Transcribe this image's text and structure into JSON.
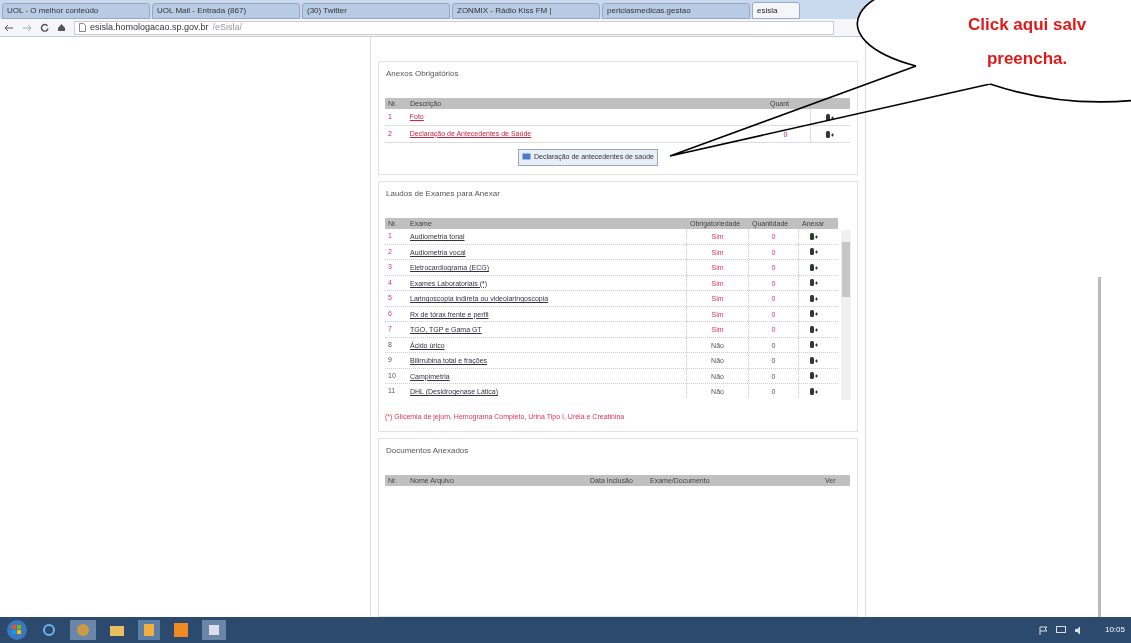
{
  "browser": {
    "tabs": [
      {
        "title": "UOL - O melhor conteúdo",
        "selected": false
      },
      {
        "title": "UOL Mail - Entrada (867)",
        "selected": false
      },
      {
        "title": "(30) Twitter",
        "selected": false
      },
      {
        "title": "ZONMIX - Rádio Kiss FM |",
        "selected": false
      },
      {
        "title": "periciasmedicas.gestao",
        "selected": false
      },
      {
        "title": "esisla",
        "selected": true
      }
    ],
    "address": {
      "host": "esisla.homologacao.sp.gov.br",
      "path": "/eSisla/"
    }
  },
  "callout": {
    "lines": [
      "Click aqui salv",
      "preencha."
    ]
  },
  "anexos_obrigatorios": {
    "legend": "Anexos Obrigatórios",
    "columns": [
      "Nr.",
      "Descrição",
      "Quant"
    ],
    "rows": [
      {
        "nr": "1",
        "descricao": "Foto",
        "quantidade": ""
      },
      {
        "nr": "2",
        "descricao": "Declaração de Antecedentes de Saúde",
        "quantidade": "0"
      }
    ],
    "button": "Declaração de antecedentes de saúde"
  },
  "laudos": {
    "legend": "Laudos de Exames para Anexar",
    "columns": [
      "Nr.",
      "Exame",
      "Obrigatoriedade",
      "Quantidade",
      "Anexar"
    ],
    "rows": [
      {
        "nr": "1",
        "exame": "Audiometria tonal",
        "obrigatoriedade": "Sim",
        "quantidade": "0",
        "required": true
      },
      {
        "nr": "2",
        "exame": "Audiometria vocal",
        "obrigatoriedade": "Sim",
        "quantidade": "0",
        "required": true
      },
      {
        "nr": "3",
        "exame": "Eletrocardiograma (ECG)",
        "obrigatoriedade": "Sim",
        "quantidade": "0",
        "required": true
      },
      {
        "nr": "4",
        "exame": "Exames Laboratoriais (*)",
        "obrigatoriedade": "Sim",
        "quantidade": "0",
        "required": true
      },
      {
        "nr": "5",
        "exame": "Laringoscopia indireta ou videolaringoscopia",
        "obrigatoriedade": "Sim",
        "quantidade": "0",
        "required": true
      },
      {
        "nr": "6",
        "exame": "Rx de tórax frente e perfil",
        "obrigatoriedade": "Sim",
        "quantidade": "0",
        "required": true
      },
      {
        "nr": "7",
        "exame": "TGO, TGP e Gama GT",
        "obrigatoriedade": "Sim",
        "quantidade": "0",
        "required": true
      },
      {
        "nr": "8",
        "exame": "Ácido úrico",
        "obrigatoriedade": "Não",
        "quantidade": "0",
        "required": false
      },
      {
        "nr": "9",
        "exame": "Bilirrubina total e frações",
        "obrigatoriedade": "Não",
        "quantidade": "0",
        "required": false
      },
      {
        "nr": "10",
        "exame": "Campimetria",
        "obrigatoriedade": "Não",
        "quantidade": "0",
        "required": false
      },
      {
        "nr": "11",
        "exame": "DHL (Desidrogenase Lática)",
        "obrigatoriedade": "Não",
        "quantidade": "0",
        "required": false
      }
    ],
    "note": "(*) Glicemia de jejum, Hemograma Completo, Urina Tipo I, Uréia e Creatinina"
  },
  "documentos": {
    "legend": "Documentos Anexados",
    "columns": [
      "Nr.",
      "Nome Arquivo",
      "Data Inclusão",
      "Exame/Documento",
      "Ver"
    ]
  },
  "taskbar": {
    "clock": "10:05"
  }
}
